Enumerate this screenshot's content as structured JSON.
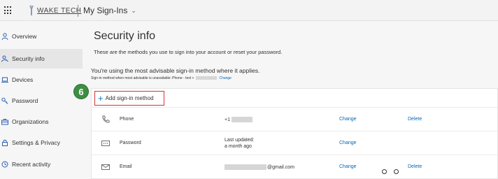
{
  "header": {
    "logo_text": "WAKE TECH",
    "app_title": "My Sign-Ins"
  },
  "sidebar": {
    "items": [
      {
        "label": "Overview",
        "icon": "person-icon"
      },
      {
        "label": "Security info",
        "icon": "key-person-icon",
        "active": true
      },
      {
        "label": "Devices",
        "icon": "laptop-icon"
      },
      {
        "label": "Password",
        "icon": "key-icon"
      },
      {
        "label": "Organizations",
        "icon": "briefcase-icon"
      },
      {
        "label": "Settings & Privacy",
        "icon": "lock-icon"
      },
      {
        "label": "Recent activity",
        "icon": "history-icon"
      }
    ]
  },
  "main": {
    "title": "Security info",
    "subtitle": "These are the methods you use to sign into your account or reset your password.",
    "advisable": "You're using the most advisable sign-in method where it applies.",
    "advisable_sub_prefix": "Sign-in method when most advisable is unavailable: Phone - text +",
    "advisable_sub_change": "Change",
    "add_method_label": "Add sign-in method",
    "step_badge": "6",
    "methods": [
      {
        "name": "Phone",
        "value": "+1",
        "change": "Change",
        "delete": "Delete",
        "icon": "phone-icon"
      },
      {
        "name": "Password",
        "value_line1": "Last updated:",
        "value_line2": "a month ago",
        "change": "Change",
        "icon": "password-icon"
      },
      {
        "name": "Email",
        "value": "@gmail.com",
        "change": "Change",
        "delete": "Delete",
        "icon": "mail-icon"
      }
    ]
  },
  "colors": {
    "accent": "#0067b8",
    "highlight_border": "#d13438",
    "step_badge": "#3e8e41"
  }
}
